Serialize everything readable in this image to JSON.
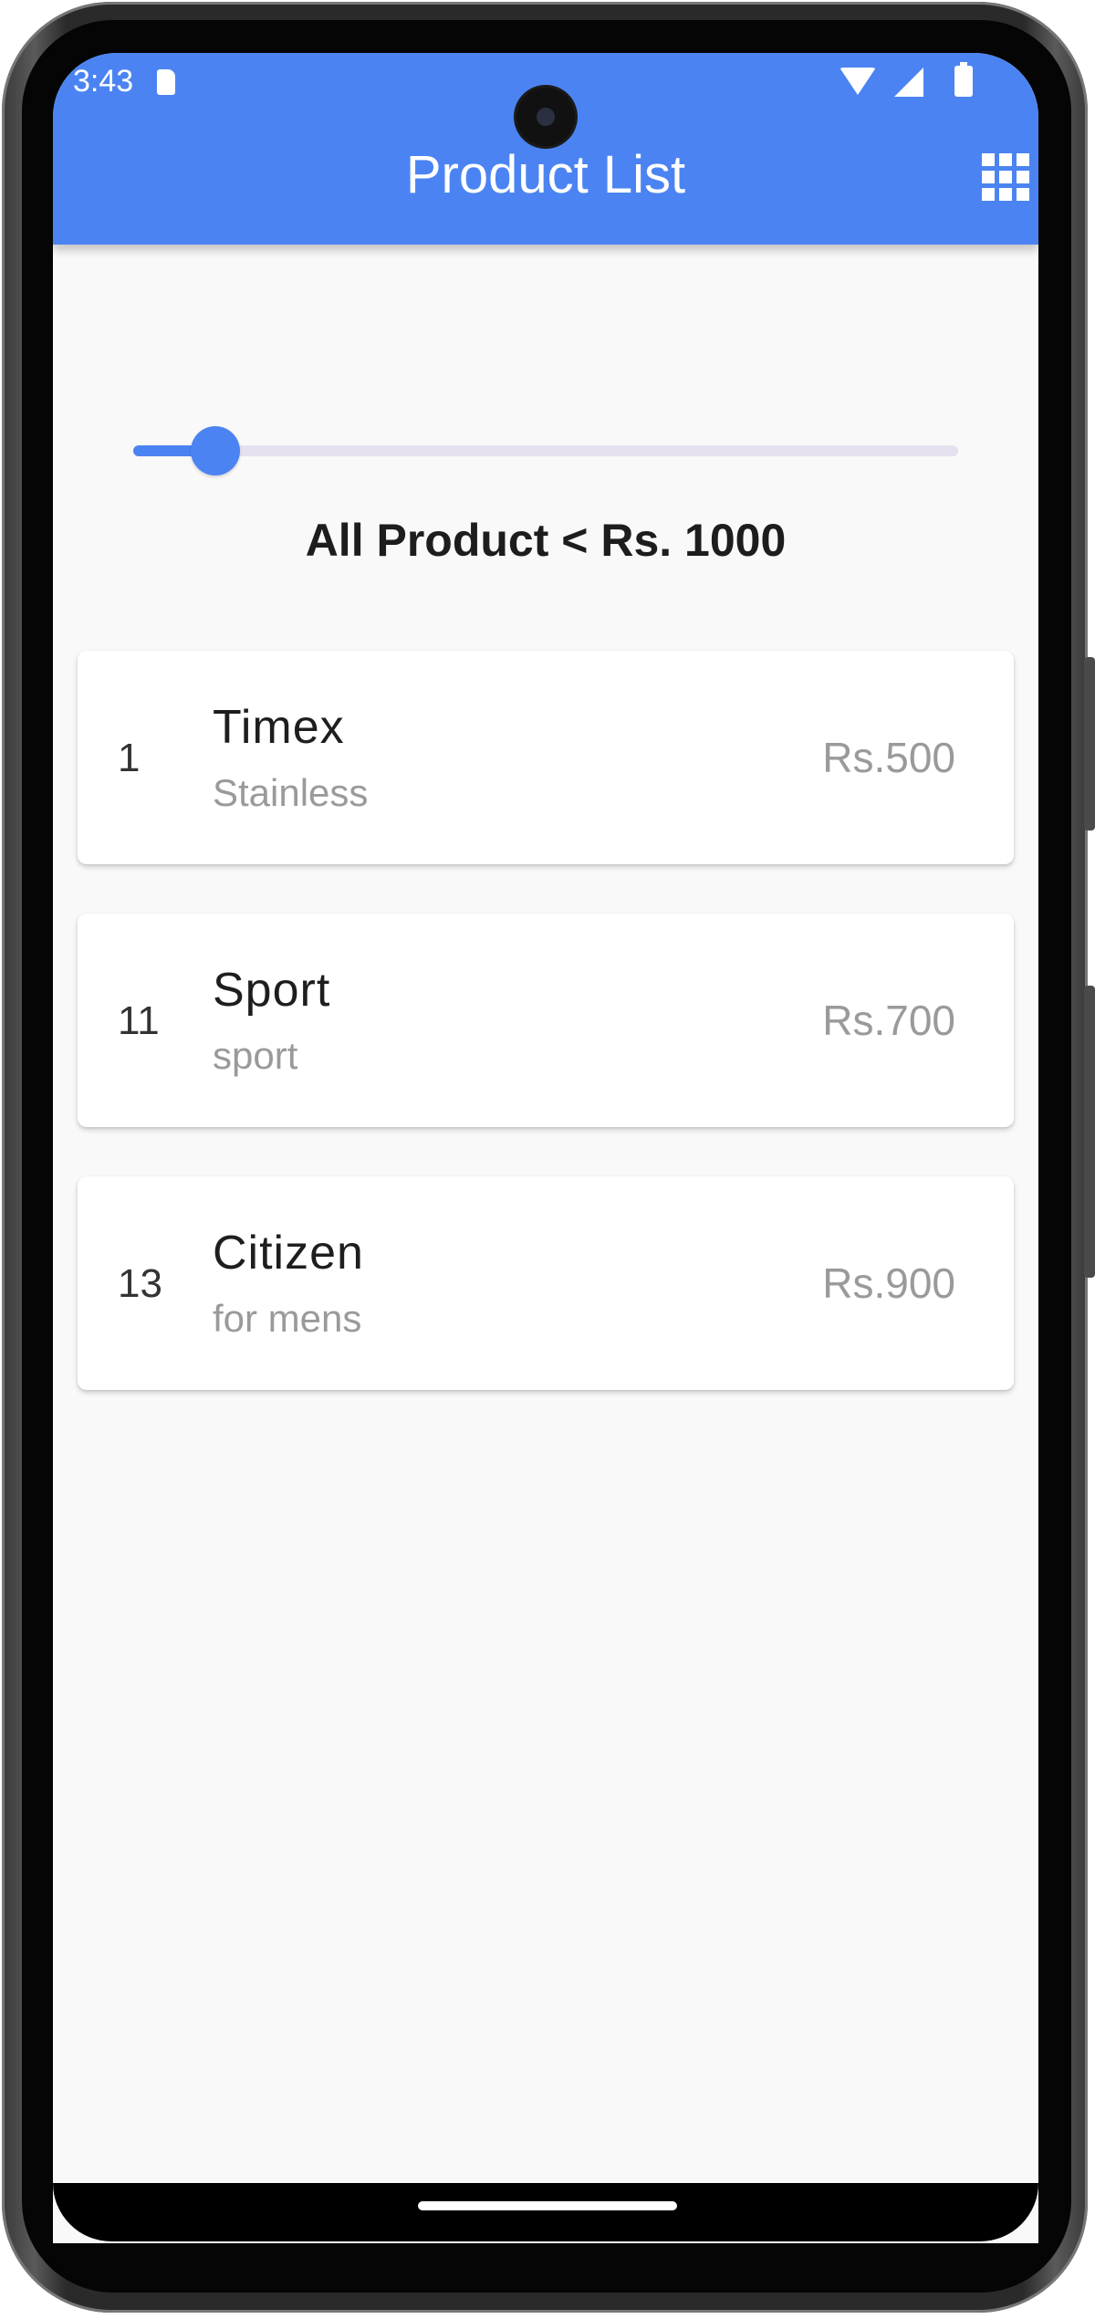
{
  "status_bar": {
    "time": "3:43"
  },
  "app_bar": {
    "title": "Product List",
    "action_icon": "grid-view-icon"
  },
  "filter": {
    "slider_value_fraction": 0.1,
    "label": "All Product < Rs. 1000"
  },
  "products": [
    {
      "id": "1",
      "name": "Timex",
      "description": "Stainless",
      "price": "Rs.500"
    },
    {
      "id": "11",
      "name": "Sport",
      "description": "sport",
      "price": "Rs.700"
    },
    {
      "id": "13",
      "name": "Citizen",
      "description": "for mens",
      "price": "Rs.900"
    }
  ],
  "colors": {
    "primary": "#4b84f2",
    "background": "#f9f9f9",
    "card": "#ffffff",
    "secondary_text": "#9a9a9a"
  }
}
